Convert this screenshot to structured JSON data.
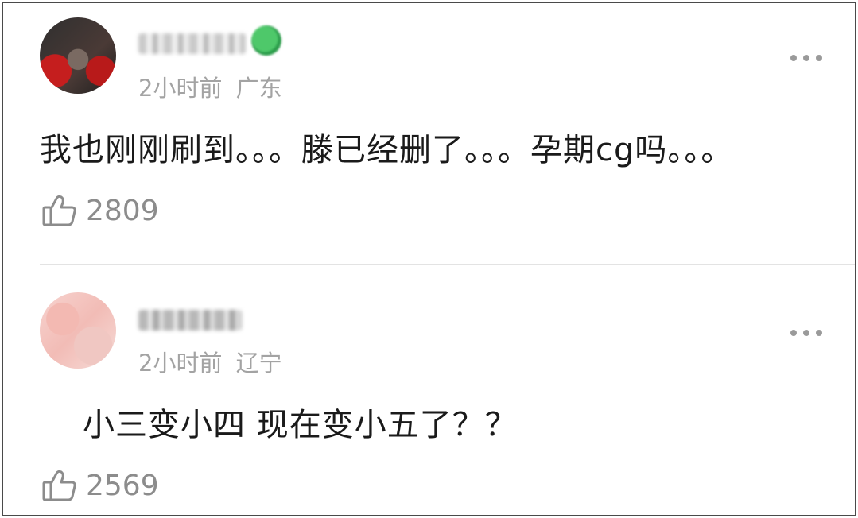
{
  "comments": [
    {
      "time": "2小时前",
      "location": "广东",
      "text": "我也刚刚刷到。。。滕已经删了。。。孕期cg吗。。。",
      "likes": "2809",
      "icons": {
        "more": "more-dots-icon",
        "like": "thumbs-up-icon"
      }
    },
    {
      "time": "2小时前",
      "location": "辽宁",
      "text": "小三变小四 现在变小五了？？",
      "likes": "2569",
      "icons": {
        "more": "more-dots-icon",
        "like": "thumbs-up-icon"
      }
    }
  ],
  "colors": {
    "meta_text": "#a3a3a3",
    "body_text": "#1a1a1a",
    "like_count": "#8c8c8c",
    "divider": "#e3e3e3",
    "badge_green": "#4ec86a"
  }
}
